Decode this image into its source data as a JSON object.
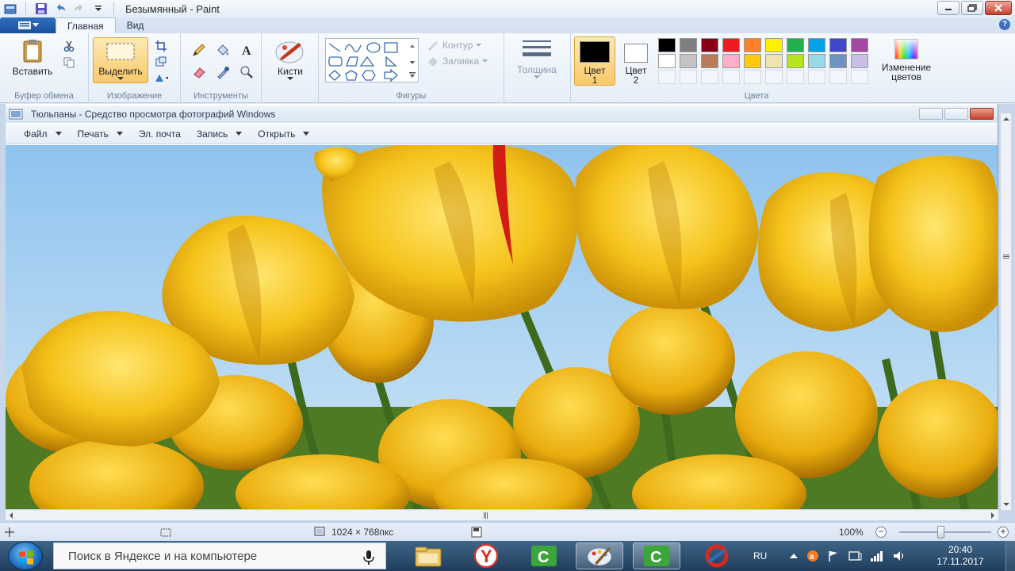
{
  "window": {
    "title": "Безымянный - Paint",
    "icons": [
      "paint-app-icon",
      "save-icon",
      "undo-icon",
      "redo-icon",
      "customize-qat-icon"
    ]
  },
  "ribbon": {
    "tabs": [
      {
        "label": "Главная",
        "active": true
      },
      {
        "label": "Вид",
        "active": false
      }
    ],
    "groups": {
      "clipboard": {
        "label": "Буфер обмена",
        "paste": "Вставить"
      },
      "image": {
        "label": "Изображение",
        "select": "Выделить"
      },
      "tools": {
        "label": "Инструменты"
      },
      "brushes": {
        "label": "Кисти"
      },
      "shapes": {
        "label": "Фигуры",
        "outline": "Контур",
        "fill": "Заливка"
      },
      "size": {
        "label": "Толщина"
      },
      "colors": {
        "label": "Цвета",
        "color1": "Цвет 1",
        "color2": "Цвет 2",
        "edit": "Изменение цветов",
        "color1_value": "#000000",
        "color2_value": "#ffffff",
        "palette": [
          "#000000",
          "#7f7f7f",
          "#880015",
          "#ed1c24",
          "#ff7f27",
          "#fff200",
          "#22b14c",
          "#00a2e8",
          "#3f48cc",
          "#a349a4",
          "#ffffff",
          "#c3c3c3",
          "#b97a57",
          "#ffaec9",
          "#ffc90e",
          "#efe4b0",
          "#b5e61d",
          "#99d9ea",
          "#7092be",
          "#c8bfe7"
        ]
      }
    }
  },
  "photo_viewer": {
    "title": "Тюльпаны - Средство просмотра фотографий Windows",
    "menu": [
      {
        "label": "Файл",
        "has_dropdown": true
      },
      {
        "label": "Печать",
        "has_dropdown": true
      },
      {
        "label": "Эл. почта",
        "has_dropdown": false
      },
      {
        "label": "Запись",
        "has_dropdown": true
      },
      {
        "label": "Открыть",
        "has_dropdown": true
      }
    ]
  },
  "status": {
    "image_size": "1024 × 768пкс",
    "zoom": "100%",
    "zoom_level": 1.0
  },
  "taskbar": {
    "search_placeholder": "Поиск в Яндексе и на компьютере",
    "apps": [
      "explorer-icon",
      "yandex-browser-icon",
      "camtasia-icon",
      "paint-icon",
      "camtasia-recorder-icon",
      "ccleaner-icon"
    ],
    "language": "RU",
    "time": "20:40",
    "date": "17.11.2017"
  }
}
